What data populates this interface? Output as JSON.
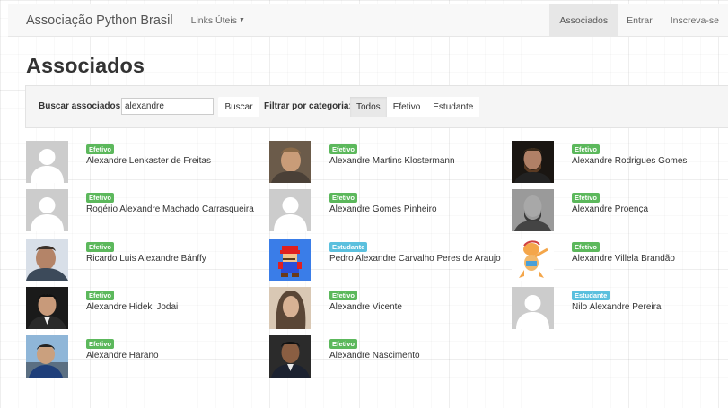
{
  "navbar": {
    "brand": "Associação Python Brasil",
    "dropdown": "Links Úteis",
    "links": [
      {
        "label": "Associados",
        "active": true
      },
      {
        "label": "Entrar",
        "active": false
      },
      {
        "label": "Inscreva-se",
        "active": false
      }
    ]
  },
  "page": {
    "title": "Associados"
  },
  "filter": {
    "search_label": "Buscar associados:",
    "search_value": "alexandre",
    "search_button": "Buscar",
    "category_label": "Filtrar por categoria:",
    "categories": [
      {
        "label": "Todos",
        "active": true
      },
      {
        "label": "Efetivo",
        "active": false
      },
      {
        "label": "Estudante",
        "active": false
      }
    ]
  },
  "colors": {
    "efetivo": "#5cb85c",
    "estudante": "#5bc0de"
  },
  "members": [
    {
      "name": "Alexandre Lenkaster de Freitas",
      "category": "Efetivo",
      "avatar": "default-avatar-icon"
    },
    {
      "name": "Alexandre Martins Klostermann",
      "category": "Efetivo",
      "avatar": "photo"
    },
    {
      "name": "Alexandre Rodrigues Gomes",
      "category": "Efetivo",
      "avatar": "photo"
    },
    {
      "name": "Rogério Alexandre Machado Carrasqueira",
      "category": "Efetivo",
      "avatar": "default-avatar-icon"
    },
    {
      "name": "Alexandre Gomes Pinheiro",
      "category": "Efetivo",
      "avatar": "default-avatar-icon"
    },
    {
      "name": "Alexandre Proença",
      "category": "Efetivo",
      "avatar": "photo"
    },
    {
      "name": "Ricardo Luis Alexandre Bánffy",
      "category": "Efetivo",
      "avatar": "photo"
    },
    {
      "name": "Pedro Alexandre Carvalho Peres de Araujo",
      "category": "Estudante",
      "avatar": "mario-icon"
    },
    {
      "name": "Alexandre Villela Brandão",
      "category": "Efetivo",
      "avatar": "cartoon-icon"
    },
    {
      "name": "Alexandre Hideki Jodai",
      "category": "Efetivo",
      "avatar": "photo"
    },
    {
      "name": "Alexandre Vicente",
      "category": "Efetivo",
      "avatar": "photo"
    },
    {
      "name": "Nilo Alexandre Pereira",
      "category": "Estudante",
      "avatar": "default-avatar-icon"
    },
    {
      "name": "Alexandre Harano",
      "category": "Efetivo",
      "avatar": "photo"
    },
    {
      "name": "Alexandre Nascimento",
      "category": "Efetivo",
      "avatar": "photo"
    }
  ]
}
